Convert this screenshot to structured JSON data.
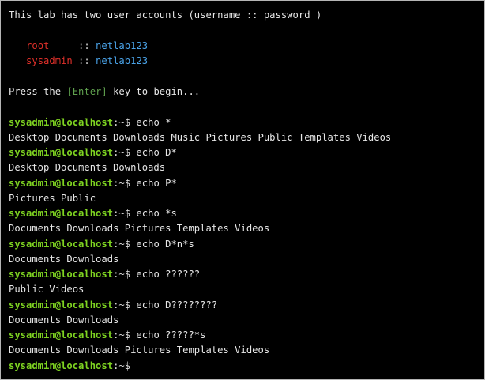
{
  "banner": {
    "intro": "This lab has two user accounts (username :: password )",
    "accounts": [
      {
        "name": "root",
        "separator": "     :: ",
        "password": "netlab123"
      },
      {
        "name": "sysadmin",
        "separator": " :: ",
        "password": "netlab123"
      }
    ],
    "press_prefix": "Press the ",
    "press_key": "[Enter]",
    "press_suffix": " key to begin..."
  },
  "prompt": {
    "user_host": "sysadmin@localhost",
    "path": ":~$"
  },
  "session": [
    {
      "command": " echo *",
      "output": "Desktop Documents Downloads Music Pictures Public Templates Videos"
    },
    {
      "command": " echo D*",
      "output": "Desktop Documents Downloads"
    },
    {
      "command": " echo P*",
      "output": "Pictures Public"
    },
    {
      "command": " echo *s",
      "output": "Documents Downloads Pictures Templates Videos"
    },
    {
      "command": " echo D*n*s",
      "output": "Documents Downloads"
    },
    {
      "command": " echo ??????",
      "output": "Public Videos"
    },
    {
      "command": " echo D????????",
      "output": "Documents Downloads"
    },
    {
      "command": " echo ?????*s",
      "output": "Documents Downloads Pictures Templates Videos"
    }
  ],
  "theme": {
    "background": "#000000",
    "prompt_color": "#7ed321",
    "account_name_color": "#e0302a",
    "password_color": "#4aa3e8",
    "enter_key_color": "#5fa04e"
  }
}
